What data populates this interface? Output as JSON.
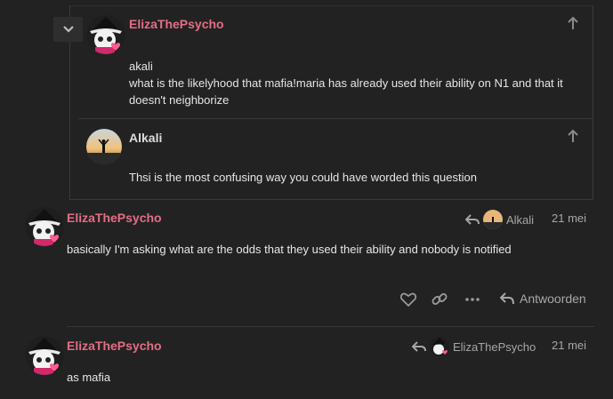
{
  "colors": {
    "background": "#222222",
    "username": "#e46d87",
    "text": "#e6e6e6",
    "muted": "#a6a6a6"
  },
  "embedded_replies": [
    {
      "username": "ElizaThePsycho",
      "lines": [
        "akali",
        "what is the likelyhood that mafia!maria has already used their ability on N1 and that it",
        "doesn't neighborize"
      ],
      "icon": "arrow-up-icon"
    },
    {
      "username": "Alkali",
      "lines": [
        "Thsi is the most confusing way you could have worded this question"
      ],
      "icon": "arrow-up-icon"
    }
  ],
  "posts": [
    {
      "username": "ElizaThePsycho",
      "reply_to": "Alkali",
      "date": "21 mei",
      "text": "basically I'm asking what are the odds that they used their ability and nobody is notified",
      "actions": {
        "like_icon": "heart-icon",
        "link_icon": "link-icon",
        "more_icon": "ellipsis-icon",
        "reply_label": "Antwoorden"
      }
    },
    {
      "username": "ElizaThePsycho",
      "reply_to": "ElizaThePsycho",
      "date": "21 mei",
      "text": "as mafia"
    }
  ]
}
